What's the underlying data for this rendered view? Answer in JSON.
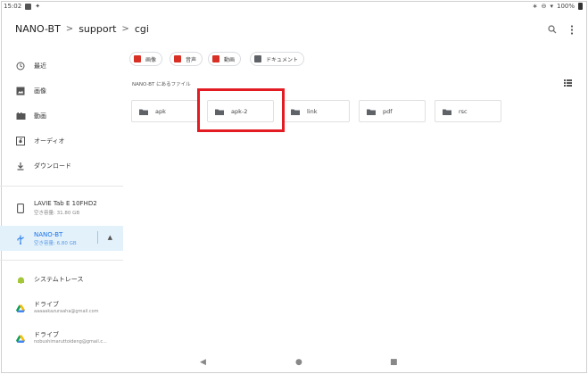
{
  "status": {
    "time": "15:02",
    "battery": "100%"
  },
  "breadcrumb": {
    "items": [
      "NANO-BT",
      "support",
      "cgi"
    ],
    "separator": ">"
  },
  "sidebar": {
    "items": [
      {
        "label": "最近",
        "icon": "clock-icon"
      },
      {
        "label": "画像",
        "icon": "image-icon"
      },
      {
        "label": "動画",
        "icon": "video-icon"
      },
      {
        "label": "オーディオ",
        "icon": "audio-icon"
      },
      {
        "label": "ダウンロード",
        "icon": "download-icon"
      }
    ],
    "devices": [
      {
        "label": "LAVIE Tab E 10FHD2",
        "sub": "空き容量: 31.80 GB",
        "icon": "tablet-icon"
      },
      {
        "label": "NANO-BT",
        "sub": "空き容量: 6.80 GB",
        "icon": "usb-icon",
        "active": true
      }
    ],
    "apps": [
      {
        "label": "システムトレース",
        "icon": "android-icon"
      },
      {
        "label": "ドライブ",
        "sub": "aaaaakazuraaha@gmail.com",
        "icon": "drive-icon"
      },
      {
        "label": "ドライブ",
        "sub": "nobushimaruttoideng@gmail.c...",
        "icon": "drive-icon"
      }
    ]
  },
  "chips": [
    {
      "label": "画像",
      "color": "#d93025"
    },
    {
      "label": "音声",
      "color": "#d93025"
    },
    {
      "label": "動画",
      "color": "#d93025"
    },
    {
      "label": "ドキュメント",
      "color": "#5f6368"
    }
  ],
  "section_label": "NANO-BT にあるファイル",
  "folders": [
    {
      "name": "apk"
    },
    {
      "name": "apk-2"
    },
    {
      "name": "link"
    },
    {
      "name": "pdf"
    },
    {
      "name": "rsc"
    }
  ],
  "colors": {
    "accent": "#1a73e8",
    "highlight": "#e31b23",
    "folder": "#5f6368"
  }
}
